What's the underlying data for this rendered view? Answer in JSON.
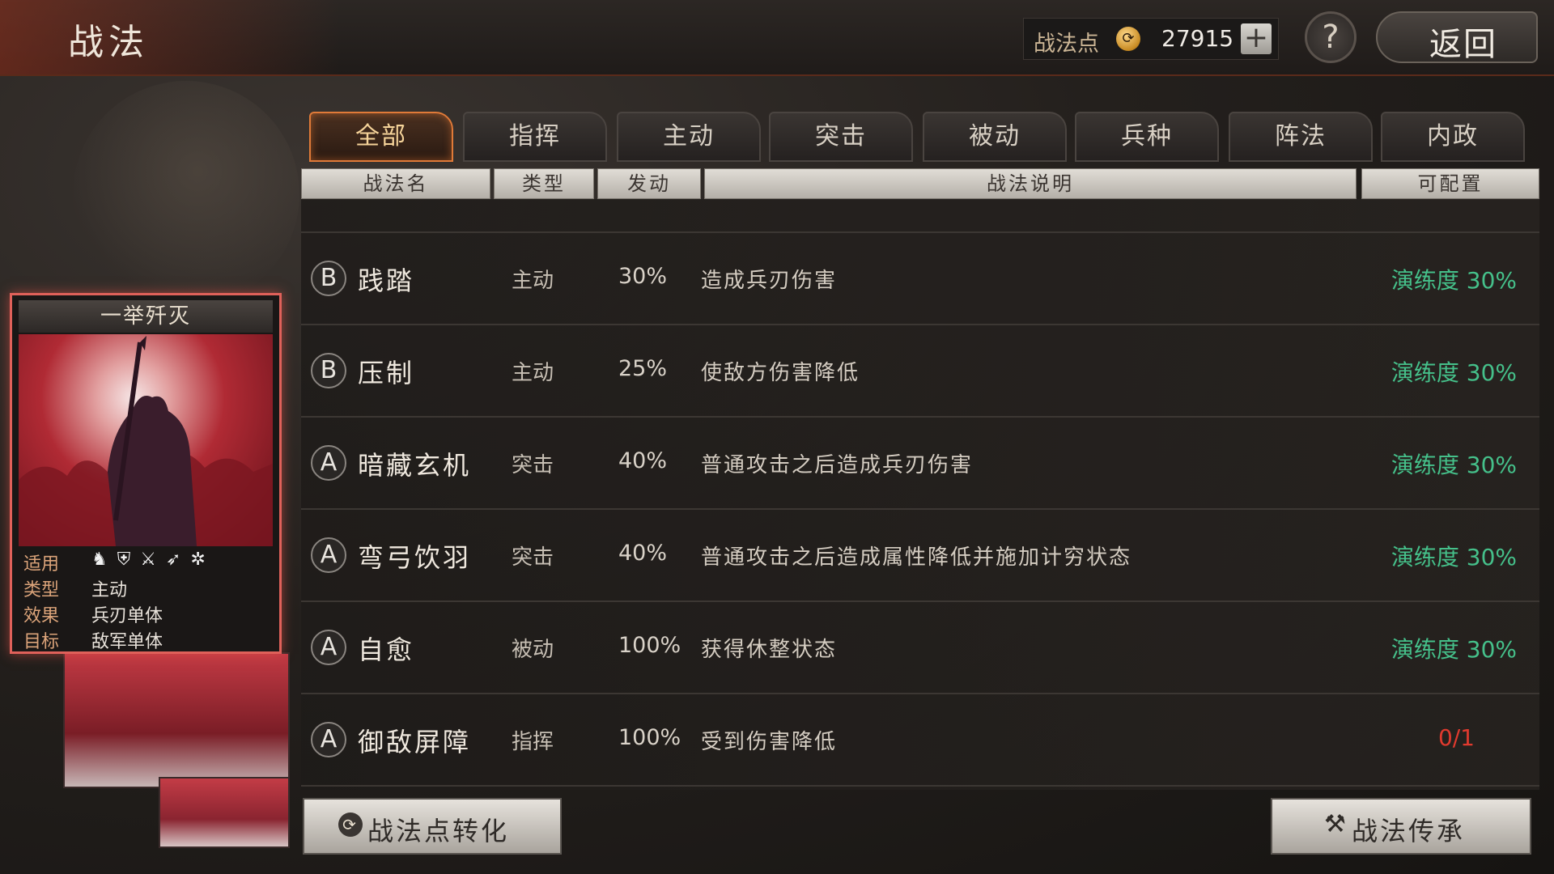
{
  "header": {
    "title": "战法",
    "points_label": "战法点",
    "points_value": "27915",
    "plus_symbol": "+",
    "help_symbol": "?",
    "back_label": "返回"
  },
  "tabs": [
    {
      "label": "全部",
      "active": true
    },
    {
      "label": "指挥",
      "active": false
    },
    {
      "label": "主动",
      "active": false
    },
    {
      "label": "突击",
      "active": false
    },
    {
      "label": "被动",
      "active": false
    },
    {
      "label": "兵种",
      "active": false
    },
    {
      "label": "阵法",
      "active": false
    },
    {
      "label": "内政",
      "active": false
    }
  ],
  "columns": {
    "name": "战法名",
    "type": "类型",
    "trigger": "发动",
    "desc": "战法说明",
    "config": "可配置"
  },
  "card": {
    "title": "一举歼灭",
    "apply_label": "适用",
    "apply_icons": [
      "horse-icon",
      "shield-icon",
      "crossed-swords-icon",
      "bow-icon",
      "wheel-icon"
    ],
    "type_label": "类型",
    "type_value": "主动",
    "effect_label": "效果",
    "effect_value": "兵刃单体",
    "target_label": "目标",
    "target_value": "敌军单体"
  },
  "skills": [
    {
      "rank": "B",
      "name": "践踏",
      "type": "主动",
      "rate": "30%",
      "desc": "造成兵刃伤害",
      "status": "演练度 30%",
      "status_color": "#45c08a"
    },
    {
      "rank": "B",
      "name": "压制",
      "type": "主动",
      "rate": "25%",
      "desc": "使敌方伤害降低",
      "status": "演练度 30%",
      "status_color": "#45c08a"
    },
    {
      "rank": "A",
      "name": "暗藏玄机",
      "type": "突击",
      "rate": "40%",
      "desc": "普通攻击之后造成兵刃伤害",
      "status": "演练度 30%",
      "status_color": "#45c08a"
    },
    {
      "rank": "A",
      "name": "弯弓饮羽",
      "type": "突击",
      "rate": "40%",
      "desc": "普通攻击之后造成属性降低并施加计穷状态",
      "status": "演练度 30%",
      "status_color": "#45c08a"
    },
    {
      "rank": "A",
      "name": "自愈",
      "type": "被动",
      "rate": "100%",
      "desc": "获得休整状态",
      "status": "演练度 30%",
      "status_color": "#45c08a"
    },
    {
      "rank": "A",
      "name": "御敌屏障",
      "type": "指挥",
      "rate": "100%",
      "desc": "受到伤害降低",
      "status": "0/1",
      "status_color": "#e03a2e"
    }
  ],
  "buttons": {
    "convert": "战法点转化",
    "inherit": "战法传承"
  },
  "colors": {
    "accent_orange": "#e07a38",
    "status_green": "#45c08a",
    "status_red": "#e03a2e",
    "card_border": "#e0615a"
  }
}
